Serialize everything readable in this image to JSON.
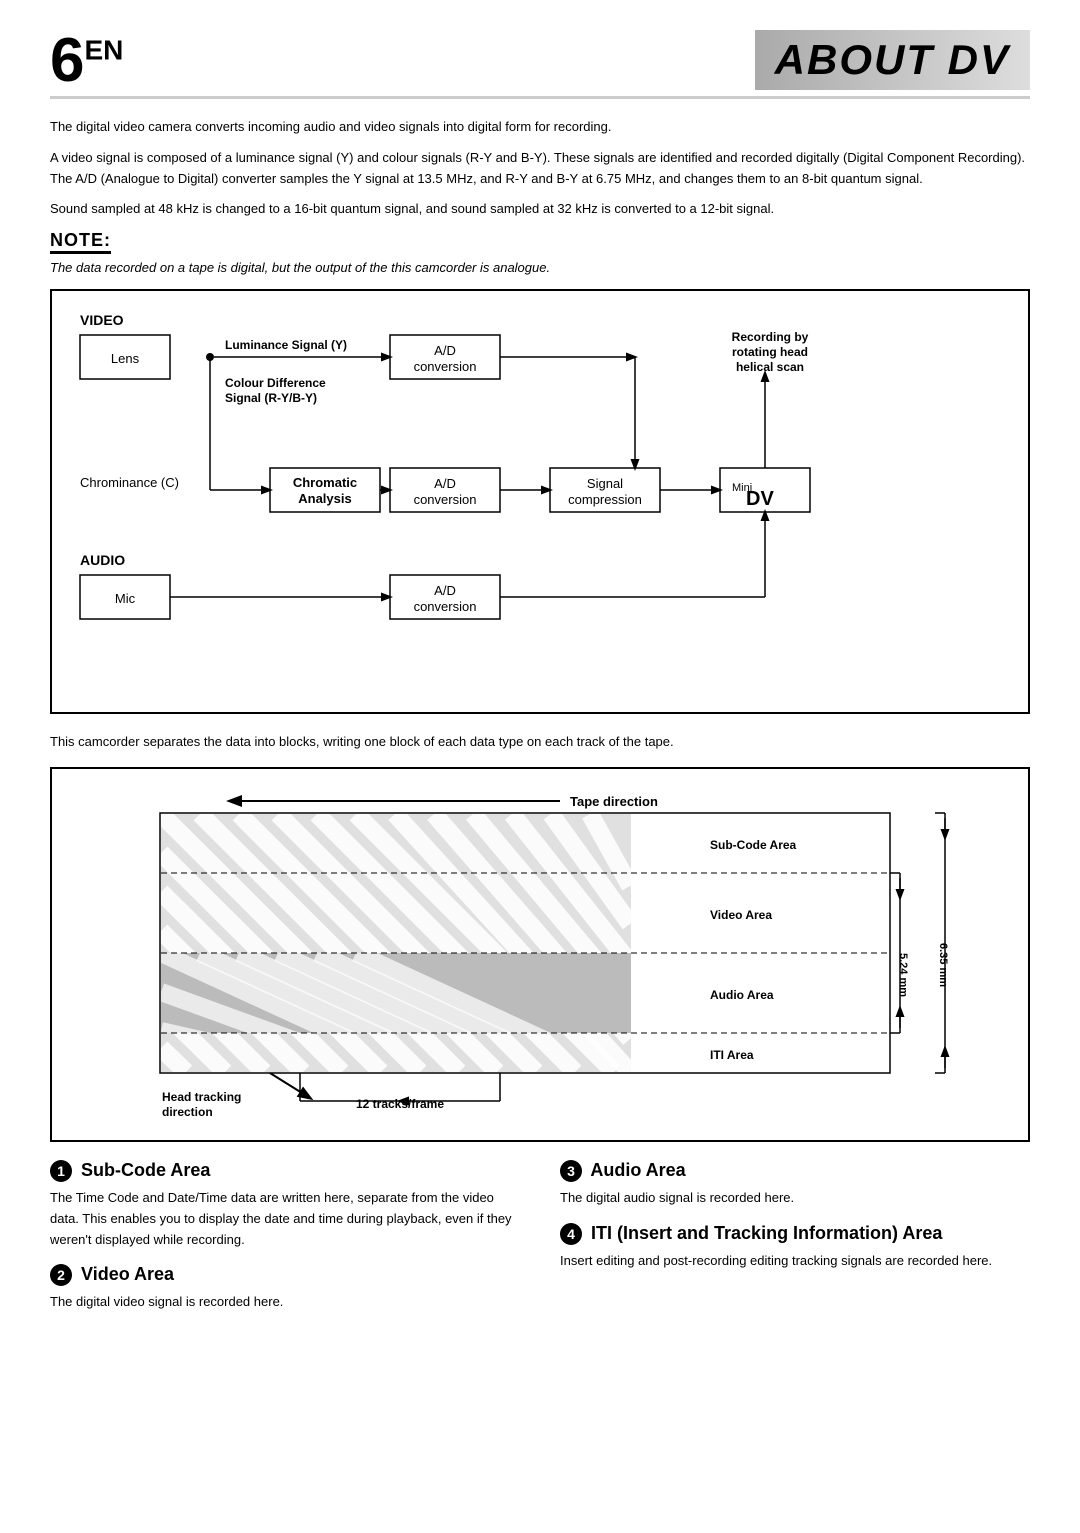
{
  "header": {
    "page_number": "6",
    "page_suffix": "EN",
    "title": "ABOUT DV"
  },
  "intro": {
    "para1": "The digital video camera converts incoming audio and video signals into digital form for recording.",
    "para2": "A video signal is composed of a luminance signal (Y) and colour signals (R-Y and B-Y). These signals are identified and recorded digitally (Digital Component Recording). The A/D (Analogue to Digital) converter samples the Y signal at 13.5 MHz, and R-Y and B-Y at 6.75 MHz, and changes them to an 8-bit quantum signal.",
    "para3": "Sound sampled at 48 kHz is changed to a 16-bit quantum signal, and sound sampled at 32 kHz is converted to a 12-bit signal."
  },
  "note": {
    "heading": "NOTE:",
    "text": "The data recorded on a tape is digital, but the output of the this camcorder is analogue."
  },
  "between": "This camcorder separates the data into blocks, writing one block of each data type on each track of the tape.",
  "sections": {
    "s1_title": "Sub-Code Area",
    "s1_body": "The Time Code and Date/Time data are written here, separate from the video data. This enables you to display the date and time during playback, even if they weren't displayed while recording.",
    "s2_title": "Video Area",
    "s2_body": "The digital video signal is recorded here.",
    "s3_title": "Audio Area",
    "s3_body": "The digital audio signal is recorded here.",
    "s4_title": "ITI (Insert and Tracking Information) Area",
    "s4_body": "Insert editing and post-recording editing tracking signals are recorded here."
  }
}
